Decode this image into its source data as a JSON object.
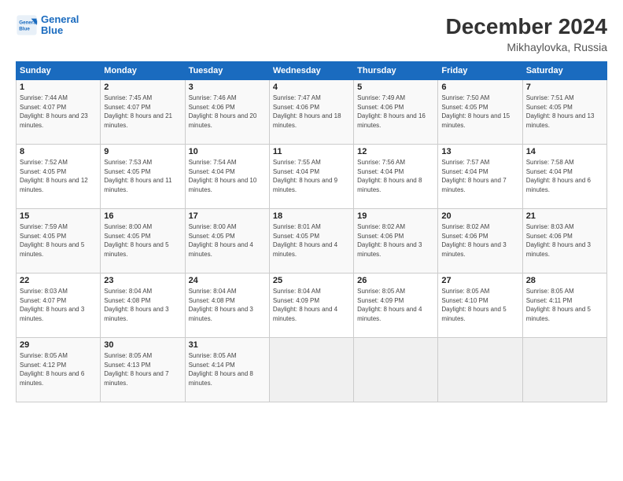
{
  "header": {
    "logo_line1": "General",
    "logo_line2": "Blue",
    "month": "December 2024",
    "location": "Mikhaylovka, Russia"
  },
  "weekdays": [
    "Sunday",
    "Monday",
    "Tuesday",
    "Wednesday",
    "Thursday",
    "Friday",
    "Saturday"
  ],
  "weeks": [
    [
      {
        "day": "1",
        "sunrise": "7:44 AM",
        "sunset": "4:07 PM",
        "daylight": "8 hours and 23 minutes."
      },
      {
        "day": "2",
        "sunrise": "7:45 AM",
        "sunset": "4:07 PM",
        "daylight": "8 hours and 21 minutes."
      },
      {
        "day": "3",
        "sunrise": "7:46 AM",
        "sunset": "4:06 PM",
        "daylight": "8 hours and 20 minutes."
      },
      {
        "day": "4",
        "sunrise": "7:47 AM",
        "sunset": "4:06 PM",
        "daylight": "8 hours and 18 minutes."
      },
      {
        "day": "5",
        "sunrise": "7:49 AM",
        "sunset": "4:06 PM",
        "daylight": "8 hours and 16 minutes."
      },
      {
        "day": "6",
        "sunrise": "7:50 AM",
        "sunset": "4:05 PM",
        "daylight": "8 hours and 15 minutes."
      },
      {
        "day": "7",
        "sunrise": "7:51 AM",
        "sunset": "4:05 PM",
        "daylight": "8 hours and 13 minutes."
      }
    ],
    [
      {
        "day": "8",
        "sunrise": "7:52 AM",
        "sunset": "4:05 PM",
        "daylight": "8 hours and 12 minutes."
      },
      {
        "day": "9",
        "sunrise": "7:53 AM",
        "sunset": "4:05 PM",
        "daylight": "8 hours and 11 minutes."
      },
      {
        "day": "10",
        "sunrise": "7:54 AM",
        "sunset": "4:04 PM",
        "daylight": "8 hours and 10 minutes."
      },
      {
        "day": "11",
        "sunrise": "7:55 AM",
        "sunset": "4:04 PM",
        "daylight": "8 hours and 9 minutes."
      },
      {
        "day": "12",
        "sunrise": "7:56 AM",
        "sunset": "4:04 PM",
        "daylight": "8 hours and 8 minutes."
      },
      {
        "day": "13",
        "sunrise": "7:57 AM",
        "sunset": "4:04 PM",
        "daylight": "8 hours and 7 minutes."
      },
      {
        "day": "14",
        "sunrise": "7:58 AM",
        "sunset": "4:04 PM",
        "daylight": "8 hours and 6 minutes."
      }
    ],
    [
      {
        "day": "15",
        "sunrise": "7:59 AM",
        "sunset": "4:05 PM",
        "daylight": "8 hours and 5 minutes."
      },
      {
        "day": "16",
        "sunrise": "8:00 AM",
        "sunset": "4:05 PM",
        "daylight": "8 hours and 5 minutes."
      },
      {
        "day": "17",
        "sunrise": "8:00 AM",
        "sunset": "4:05 PM",
        "daylight": "8 hours and 4 minutes."
      },
      {
        "day": "18",
        "sunrise": "8:01 AM",
        "sunset": "4:05 PM",
        "daylight": "8 hours and 4 minutes."
      },
      {
        "day": "19",
        "sunrise": "8:02 AM",
        "sunset": "4:06 PM",
        "daylight": "8 hours and 3 minutes."
      },
      {
        "day": "20",
        "sunrise": "8:02 AM",
        "sunset": "4:06 PM",
        "daylight": "8 hours and 3 minutes."
      },
      {
        "day": "21",
        "sunrise": "8:03 AM",
        "sunset": "4:06 PM",
        "daylight": "8 hours and 3 minutes."
      }
    ],
    [
      {
        "day": "22",
        "sunrise": "8:03 AM",
        "sunset": "4:07 PM",
        "daylight": "8 hours and 3 minutes."
      },
      {
        "day": "23",
        "sunrise": "8:04 AM",
        "sunset": "4:08 PM",
        "daylight": "8 hours and 3 minutes."
      },
      {
        "day": "24",
        "sunrise": "8:04 AM",
        "sunset": "4:08 PM",
        "daylight": "8 hours and 3 minutes."
      },
      {
        "day": "25",
        "sunrise": "8:04 AM",
        "sunset": "4:09 PM",
        "daylight": "8 hours and 4 minutes."
      },
      {
        "day": "26",
        "sunrise": "8:05 AM",
        "sunset": "4:09 PM",
        "daylight": "8 hours and 4 minutes."
      },
      {
        "day": "27",
        "sunrise": "8:05 AM",
        "sunset": "4:10 PM",
        "daylight": "8 hours and 5 minutes."
      },
      {
        "day": "28",
        "sunrise": "8:05 AM",
        "sunset": "4:11 PM",
        "daylight": "8 hours and 5 minutes."
      }
    ],
    [
      {
        "day": "29",
        "sunrise": "8:05 AM",
        "sunset": "4:12 PM",
        "daylight": "8 hours and 6 minutes."
      },
      {
        "day": "30",
        "sunrise": "8:05 AM",
        "sunset": "4:13 PM",
        "daylight": "8 hours and 7 minutes."
      },
      {
        "day": "31",
        "sunrise": "8:05 AM",
        "sunset": "4:14 PM",
        "daylight": "8 hours and 8 minutes."
      },
      null,
      null,
      null,
      null
    ]
  ]
}
